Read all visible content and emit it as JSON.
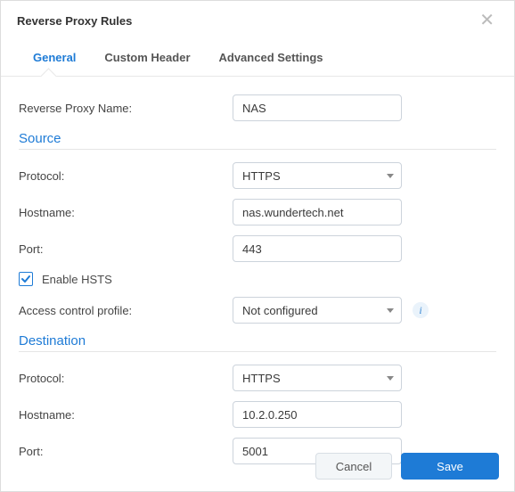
{
  "header": {
    "title": "Reverse Proxy Rules"
  },
  "tabs": {
    "general": "General",
    "custom_header": "Custom Header",
    "advanced": "Advanced Settings"
  },
  "form": {
    "name_label": "Reverse Proxy Name:",
    "name_value": "NAS",
    "source": {
      "heading": "Source",
      "protocol_label": "Protocol:",
      "protocol_value": "HTTPS",
      "hostname_label": "Hostname:",
      "hostname_value": "nas.wundertech.net",
      "port_label": "Port:",
      "port_value": "443",
      "hsts_label": "Enable HSTS",
      "acp_label": "Access control profile:",
      "acp_value": "Not configured"
    },
    "destination": {
      "heading": "Destination",
      "protocol_label": "Protocol:",
      "protocol_value": "HTTPS",
      "hostname_label": "Hostname:",
      "hostname_value": "10.2.0.250",
      "port_label": "Port:",
      "port_value": "5001"
    }
  },
  "footer": {
    "cancel": "Cancel",
    "save": "Save"
  }
}
